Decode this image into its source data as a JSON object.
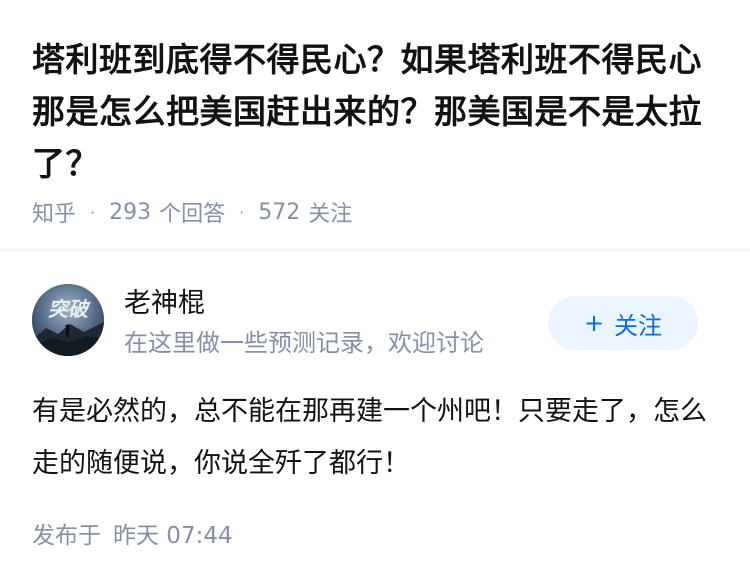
{
  "question": {
    "title": "塔利班到底得不得民心？如果塔利班不得民心那是怎么把美国赶出来的？那美国是不是太拉了？",
    "source": "知乎",
    "answers_count": "293",
    "answers_label": "个回答",
    "followers_count": "572",
    "followers_label": "关注"
  },
  "author": {
    "name": "老神棍",
    "bio": "在这里做一些预测记录，欢迎讨论",
    "avatar_text": "突破",
    "follow_label": "关注"
  },
  "answer": {
    "content": "有是必然的，总不能在那再建一个州吧！只要走了，怎么走的随便说，你说全歼了都行！",
    "published_label": "发布于",
    "published_time": "昨天 07:44"
  },
  "colors": {
    "accent": "#056de8",
    "accent_bg": "#ebf5ff",
    "meta_gray": "#8590a6",
    "text": "#121212"
  }
}
